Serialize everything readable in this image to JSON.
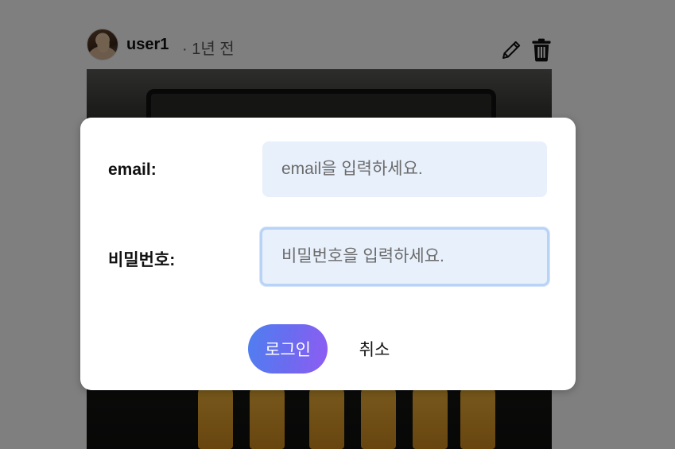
{
  "post": {
    "username": "user1",
    "time": "· 1년 전",
    "icons": {
      "edit": "pencil-icon",
      "delete": "trash-icon"
    }
  },
  "login_modal": {
    "email_label": "email:",
    "email_placeholder": "email을 입력하세요.",
    "password_label": "비밀번호:",
    "password_placeholder": "비밀번호을 입력하세요.",
    "login_button": "로그인",
    "cancel_button": "취소"
  },
  "colors": {
    "overlay": "#808080",
    "input_bg": "#e8f0fb",
    "focus_border": "#b9d3f6",
    "button_gradient_start": "#4f7ff0",
    "button_gradient_end": "#8f5cf2"
  }
}
